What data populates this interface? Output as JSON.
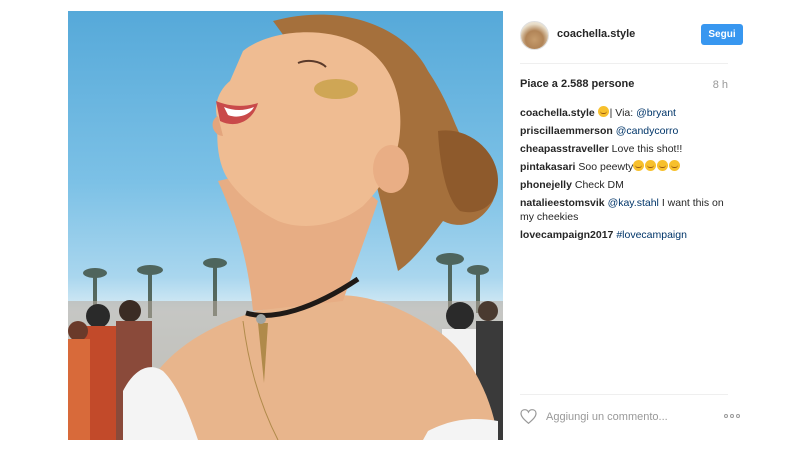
{
  "post": {
    "username": "coachella.style",
    "follow_label": "Segui",
    "likes": "Piace a 2.588 persone",
    "time": "8 h",
    "comments": [
      {
        "user": "coachella.style",
        "emoji": "smiling-face",
        "text": "| Via: ",
        "tag": "@bryant"
      },
      {
        "user": "priscillaemmerson",
        "text": "",
        "tag": "@candycorro"
      },
      {
        "user": "cheapasstraveller",
        "text": "Love this shot!!",
        "tag": ""
      },
      {
        "user": "pintakasari",
        "text": "Soo peewty",
        "emoji_count": 4
      },
      {
        "user": "phonejelly",
        "text": "Check DM",
        "tag": ""
      },
      {
        "user": "natalieestomsvik",
        "tag": "@kay.stahl",
        "text": "I want this on my cheekies"
      },
      {
        "user": "lovecampaign2017",
        "text": "",
        "tag": "#lovecampaign"
      }
    ],
    "add_comment_placeholder": "Aggiungi un commento...",
    "icons": {
      "like": "heart-icon",
      "more": "more-options-icon"
    }
  },
  "colors": {
    "accent": "#3897f0",
    "link": "#003569",
    "muted": "#999999"
  }
}
